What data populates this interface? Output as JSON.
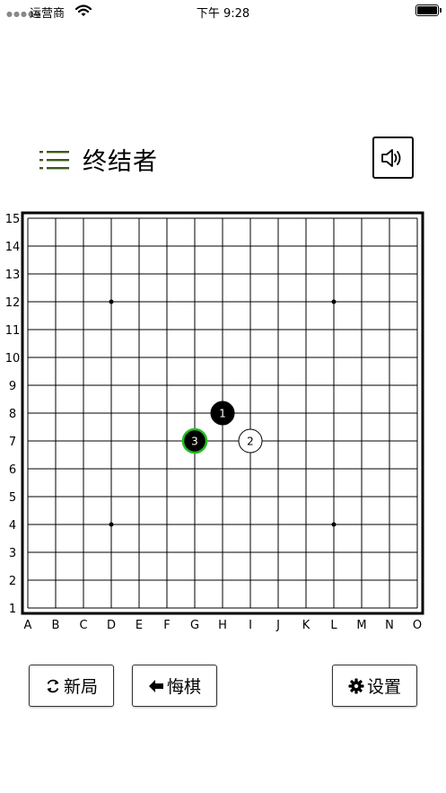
{
  "status_bar": {
    "carrier": "运营商",
    "time": "下午 9:28"
  },
  "header": {
    "title": "终结者",
    "menu_icon": "list-icon",
    "sound_icon": "speaker-icon"
  },
  "board": {
    "size": 15,
    "columns": [
      "A",
      "B",
      "C",
      "D",
      "E",
      "F",
      "G",
      "H",
      "I",
      "J",
      "K",
      "L",
      "M",
      "N",
      "O"
    ],
    "rows": [
      "1",
      "2",
      "3",
      "4",
      "5",
      "6",
      "7",
      "8",
      "9",
      "10",
      "11",
      "12",
      "13",
      "14",
      "15"
    ],
    "star_points": [
      [
        "D",
        12
      ],
      [
        "L",
        12
      ],
      [
        "D",
        4
      ],
      [
        "L",
        4
      ]
    ],
    "stones": [
      {
        "number": "1",
        "color": "black",
        "col": "H",
        "row": 8,
        "last": false
      },
      {
        "number": "2",
        "color": "white",
        "col": "I",
        "row": 7,
        "last": false
      },
      {
        "number": "3",
        "color": "black",
        "col": "G",
        "row": 7,
        "last": true
      }
    ],
    "last_move_color": "#22bb22"
  },
  "buttons": {
    "new_game": "新局",
    "undo": "悔棋",
    "settings": "设置"
  },
  "colors": {
    "accent": "#3a5a1a"
  }
}
